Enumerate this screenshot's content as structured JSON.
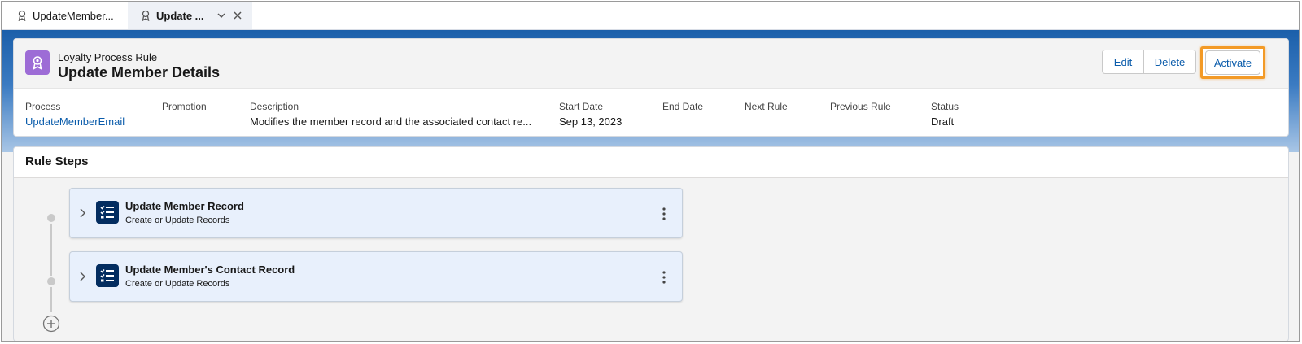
{
  "tabs": [
    {
      "label": "UpdateMember...",
      "icon": "loyalty-rule-icon"
    },
    {
      "label": "Update ...",
      "icon": "loyalty-rule-icon",
      "active": true
    }
  ],
  "header": {
    "object_type": "Loyalty Process Rule",
    "title": "Update Member Details",
    "icon": "loyalty-rule-icon",
    "buttons": {
      "edit": "Edit",
      "delete": "Delete",
      "activate": "Activate"
    }
  },
  "fields": {
    "process": {
      "label": "Process",
      "value": "UpdateMemberEmail"
    },
    "promotion": {
      "label": "Promotion",
      "value": ""
    },
    "description": {
      "label": "Description",
      "value": "Modifies the member record and the associated contact re..."
    },
    "start_date": {
      "label": "Start Date",
      "value": "Sep 13, 2023"
    },
    "end_date": {
      "label": "End Date",
      "value": ""
    },
    "next_rule": {
      "label": "Next Rule",
      "value": ""
    },
    "previous_rule": {
      "label": "Previous Rule",
      "value": ""
    },
    "status": {
      "label": "Status",
      "value": "Draft"
    }
  },
  "rule_steps": {
    "title": "Rule Steps",
    "steps": [
      {
        "name": "Update Member Record",
        "type": "Create or Update Records",
        "icon": "checklist-icon"
      },
      {
        "name": "Update Member's Contact Record",
        "type": "Create or Update Records",
        "icon": "checklist-icon"
      }
    ]
  },
  "colors": {
    "accent": "#0b5cab",
    "record_icon_bg": "#9d6cd6",
    "step_icon_bg": "#032d60",
    "highlight": "#f39a26",
    "step_bg": "#e8f0fc"
  }
}
